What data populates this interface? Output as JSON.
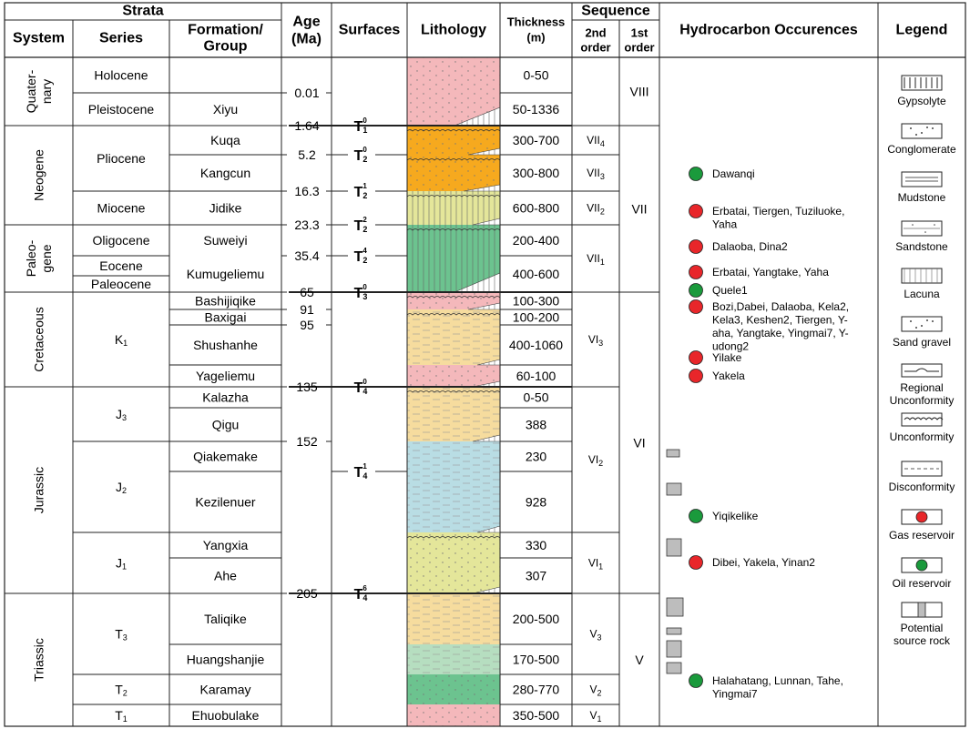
{
  "headers": {
    "strata": "Strata",
    "system": "System",
    "series": "Series",
    "formation": [
      "Formation/",
      "Group"
    ],
    "age": [
      "Age",
      "(Ma)"
    ],
    "surfaces": "Surfaces",
    "lithology": "Lithology",
    "thickness": [
      "Thickness",
      "(m)"
    ],
    "sequence": "Sequence",
    "second_order": [
      "2nd",
      "order"
    ],
    "first_order": [
      "1st",
      "order"
    ],
    "hydrocarbon": "Hydrocarbon Occurences",
    "legend": "Legend"
  },
  "systems": [
    {
      "lines": [
        "Quater-",
        "nary"
      ]
    },
    {
      "lines": [
        "Neogene"
      ]
    },
    {
      "lines": [
        "Paleo-",
        "gene"
      ]
    },
    {
      "lines": [
        "Cretaceous"
      ]
    },
    {
      "lines": [
        "Jurassic"
      ]
    },
    {
      "lines": [
        "Triassic"
      ]
    }
  ],
  "series": [
    {
      "label": "Holocene"
    },
    {
      "label": "Pleistocene"
    },
    {
      "label": "Pliocene"
    },
    {
      "label": "Miocene"
    },
    {
      "label": "Oligocene"
    },
    {
      "label": "Eocene"
    },
    {
      "label": "Paleocene"
    },
    {
      "label": "K",
      "sub": "1"
    },
    {
      "label": "J",
      "sub": "3"
    },
    {
      "label": "J",
      "sub": "2"
    },
    {
      "label": "J",
      "sub": "1"
    },
    {
      "label": "T",
      "sub": "3"
    },
    {
      "label": "T",
      "sub": "2"
    },
    {
      "label": "T",
      "sub": "1"
    }
  ],
  "formations": [
    {
      "name": "",
      "thickness": "0-50"
    },
    {
      "name": "Xiyu",
      "thickness": "50-1336"
    },
    {
      "name": "Kuqa",
      "thickness": "300-700"
    },
    {
      "name": "Kangcun",
      "thickness": "300-800"
    },
    {
      "name": "Jidike",
      "thickness": "600-800"
    },
    {
      "name": "Suweiyi",
      "thickness": "200-400"
    },
    {
      "name": "Kumugeliemu",
      "thickness": "400-600"
    },
    {
      "name": "Bashijiqike",
      "thickness": "100-300"
    },
    {
      "name": "Baxigai",
      "thickness": "100-200"
    },
    {
      "name": "Shushanhe",
      "thickness": "400-1060"
    },
    {
      "name": "Yageliemu",
      "thickness": "60-100"
    },
    {
      "name": "Kalazha",
      "thickness": "0-50"
    },
    {
      "name": "Qigu",
      "thickness": "388"
    },
    {
      "name": "Qiakemake",
      "thickness": "230"
    },
    {
      "name": "Kezilenuer",
      "thickness": "928"
    },
    {
      "name": "Yangxia",
      "thickness": "330"
    },
    {
      "name": "Ahe",
      "thickness": "307"
    },
    {
      "name": "Taliqike",
      "thickness": "200-500"
    },
    {
      "name": "Huangshanjie",
      "thickness": "170-500"
    },
    {
      "name": "Karamay",
      "thickness": "280-770"
    },
    {
      "name": "Ehuobulake",
      "thickness": "350-500"
    }
  ],
  "ages": [
    "0.01",
    "1.64",
    "5.2",
    "16.3",
    "23.3",
    "35.4",
    "65",
    "91",
    "95",
    "135",
    "152",
    "205"
  ],
  "surfaces": [
    {
      "base": "T",
      "sub": "1",
      "sup": "0"
    },
    {
      "base": "T",
      "sub": "2",
      "sup": "0"
    },
    {
      "base": "T",
      "sub": "2",
      "sup": "1"
    },
    {
      "base": "T",
      "sub": "2",
      "sup": "2"
    },
    {
      "base": "T",
      "sub": "2",
      "sup": "4"
    },
    {
      "base": "T",
      "sub": "3",
      "sup": "0"
    },
    {
      "base": "T",
      "sub": "4",
      "sup": "0"
    },
    {
      "base": "T",
      "sub": "4",
      "sup": "1"
    },
    {
      "base": "T",
      "sub": "4",
      "sup": "6"
    }
  ],
  "second_order": [
    {
      "label": "VII",
      "sub": "4"
    },
    {
      "label": "VII",
      "sub": "3"
    },
    {
      "label": "VII",
      "sub": "2"
    },
    {
      "label": "VII",
      "sub": "1"
    },
    {
      "label": "VI",
      "sub": "3"
    },
    {
      "label": "VI",
      "sub": "2"
    },
    {
      "label": "VI",
      "sub": "1"
    },
    {
      "label": "V",
      "sub": "3"
    },
    {
      "label": "V",
      "sub": "2"
    },
    {
      "label": "V",
      "sub": "1"
    }
  ],
  "first_order": [
    "VIII",
    "VII",
    "VI",
    "V"
  ],
  "occurrences": [
    {
      "type": "oil",
      "lines": [
        "Dawanqi"
      ]
    },
    {
      "type": "gas",
      "lines": [
        "Erbatai, Tiergen, Tuziluoke,",
        "Yaha"
      ]
    },
    {
      "type": "gas",
      "lines": [
        "Dalaoba, Dina2"
      ]
    },
    {
      "type": "gas",
      "lines": [
        "Erbatai, Yangtake, Yaha"
      ]
    },
    {
      "type": "oil",
      "lines": [
        "Quele1"
      ]
    },
    {
      "type": "gas",
      "lines": [
        "Bozi,Dabei, Dalaoba, Kela2,",
        "Kela3, Keshen2, Tiergen, Y-",
        "aha, Yangtake, Yingmai7, Y-",
        "udong2"
      ]
    },
    {
      "type": "gas",
      "lines": [
        "Yilake"
      ]
    },
    {
      "type": "gas",
      "lines": [
        "Yakela"
      ]
    },
    {
      "type": "oil",
      "lines": [
        "Yiqikelike"
      ]
    },
    {
      "type": "gas",
      "lines": [
        "Dibei, Yakela, Yinan2"
      ]
    },
    {
      "type": "oil",
      "lines": [
        "Halahatang, Lunnan, Tahe,",
        "Yingmai7"
      ]
    }
  ],
  "legend": [
    {
      "key": "gypsolyte",
      "lines": [
        "Gypsolyte"
      ]
    },
    {
      "key": "conglomerate",
      "lines": [
        "Conglomerate"
      ]
    },
    {
      "key": "mudstone",
      "lines": [
        "Mudstone"
      ]
    },
    {
      "key": "sandstone",
      "lines": [
        "Sandstone"
      ]
    },
    {
      "key": "lacuna",
      "lines": [
        "Lacuna"
      ]
    },
    {
      "key": "sandgravel",
      "lines": [
        "Sand gravel"
      ]
    },
    {
      "key": "regional",
      "lines": [
        "Regional",
        "Unconformity"
      ]
    },
    {
      "key": "unconformity",
      "lines": [
        "Unconformity"
      ]
    },
    {
      "key": "disconformity",
      "lines": [
        "Disconformity"
      ]
    },
    {
      "key": "gas",
      "lines": [
        "Gas reservoir"
      ]
    },
    {
      "key": "oil",
      "lines": [
        "Oil reservoir"
      ]
    },
    {
      "key": "source",
      "lines": [
        "Potential",
        "source rock"
      ]
    }
  ],
  "colors": {
    "gas": "#e8262a",
    "oil": "#1a9a3c",
    "pink": "#f4b8bb",
    "orange": "#f6a91e",
    "yellowgreen": "#e4e69a",
    "green": "#6cc38f",
    "sand": "#f6dc9e",
    "blue": "#b9dde4",
    "lightgreen": "#b6dec0",
    "source": "#bdbdbd"
  }
}
